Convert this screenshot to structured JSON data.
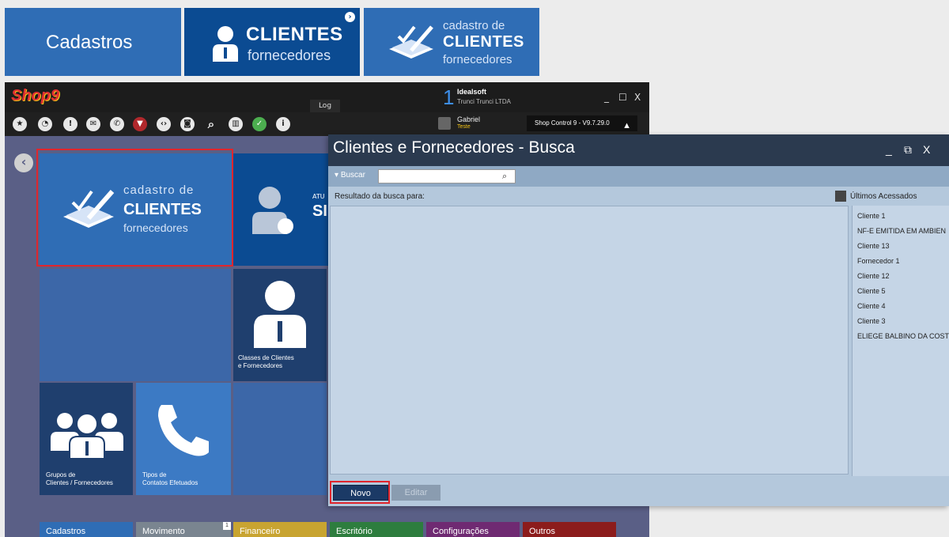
{
  "breadcrumb": {
    "item1": "Cadastros",
    "item2_title": "CLIENTES",
    "item2_sub": "fornecedores",
    "item3_small": "cadastro de",
    "item3_title": "CLIENTES",
    "item3_sub": "fornecedores"
  },
  "app": {
    "logo": "Shop9",
    "log_tab": "Log",
    "company_number": "1",
    "company_name": "Idealsoft",
    "company_desc": "Trunci Trunci LTDA",
    "user_name": "Gabriel",
    "user_role": "Teste",
    "version": "Shop Control 9 - V9.7.29.0",
    "min": "_",
    "max": "☐",
    "close": "X"
  },
  "toolbar_icons": [
    "star-icon",
    "speedometer-icon",
    "alert-icon",
    "mail-icon",
    "whatsapp-icon",
    "bookmark-icon",
    "code-icon",
    "camera-icon",
    "search-icon",
    "chart-icon",
    "check-icon",
    "info-icon"
  ],
  "tiles": {
    "main_small": "cadastro de",
    "main_title": "CLIENTES",
    "main_sub": "fornecedores",
    "att_label": "ATU",
    "att_big": "SI",
    "classes_caption_line1": "Classes de Clientes",
    "classes_caption_line2": "e Fornecedores",
    "groups_caption_line1": "Grupos de",
    "groups_caption_line2": "Clientes / Fornecedores",
    "phone_caption_line1": "Tipos de",
    "phone_caption_line2": "Contatos Efetuados"
  },
  "bottom_tabs": [
    {
      "label": "Cadastros",
      "color": "#2f6db5"
    },
    {
      "label": "Movimento",
      "color": "#7a8590",
      "badge": "1"
    },
    {
      "label": "Financeiro",
      "color": "#c8a431"
    },
    {
      "label": "Escritório",
      "color": "#2d7d3e"
    },
    {
      "label": "Configurações",
      "color": "#6f2a72"
    },
    {
      "label": "Outros",
      "color": "#8c1c1c"
    }
  ],
  "busca": {
    "title": "Clientes e Fornecedores - Busca",
    "search_label": "Buscar",
    "search_value": "",
    "result_label": "Resultado da busca para:",
    "last_label": "Últimos Acessados",
    "recent": [
      "Cliente 1",
      "NF-E EMITIDA EM AMBIEN",
      "Cliente 13",
      "Fornecedor 1",
      "Cliente 12",
      "Cliente 5",
      "Cliente 4",
      "Cliente 3",
      "ELIEGE BALBINO DA COST"
    ],
    "btn_novo": "Novo",
    "btn_editar": "Editar",
    "min": "_",
    "restore": "⧉",
    "close": "X"
  }
}
